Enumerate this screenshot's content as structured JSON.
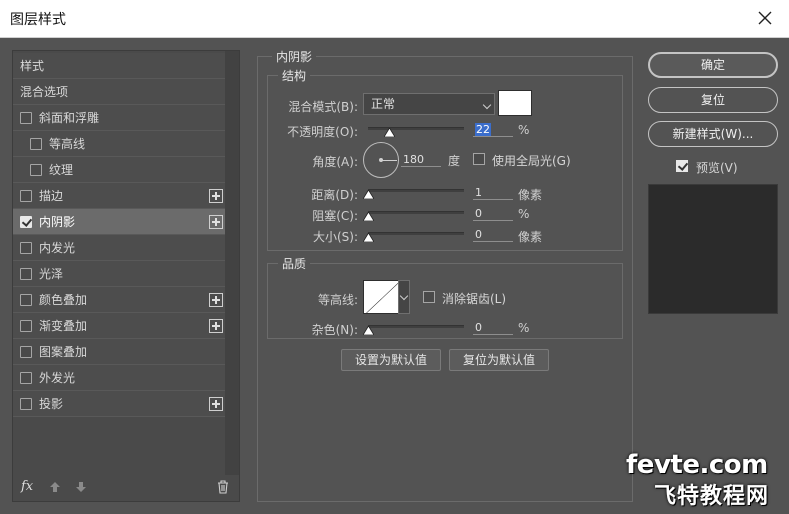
{
  "window": {
    "title": "图层样式"
  },
  "styles_list": {
    "header_styles": "样式",
    "header_blend": "混合选项",
    "items": [
      {
        "label": "斜面和浮雕",
        "checked": false,
        "indent": false,
        "plus": false,
        "selected": false
      },
      {
        "label": "等高线",
        "checked": false,
        "indent": true,
        "plus": false,
        "selected": false
      },
      {
        "label": "纹理",
        "checked": false,
        "indent": true,
        "plus": false,
        "selected": false
      },
      {
        "label": "描边",
        "checked": false,
        "indent": false,
        "plus": true,
        "selected": false
      },
      {
        "label": "内阴影",
        "checked": true,
        "indent": false,
        "plus": true,
        "selected": true
      },
      {
        "label": "内发光",
        "checked": false,
        "indent": false,
        "plus": false,
        "selected": false
      },
      {
        "label": "光泽",
        "checked": false,
        "indent": false,
        "plus": false,
        "selected": false
      },
      {
        "label": "颜色叠加",
        "checked": false,
        "indent": false,
        "plus": true,
        "selected": false
      },
      {
        "label": "渐变叠加",
        "checked": false,
        "indent": false,
        "plus": true,
        "selected": false
      },
      {
        "label": "图案叠加",
        "checked": false,
        "indent": false,
        "plus": false,
        "selected": false
      },
      {
        "label": "外发光",
        "checked": false,
        "indent": false,
        "plus": false,
        "selected": false
      },
      {
        "label": "投影",
        "checked": false,
        "indent": false,
        "plus": true,
        "selected": false
      }
    ],
    "fx_label": "fx"
  },
  "inner_shadow": {
    "title": "内阴影",
    "structure": {
      "title": "结构",
      "blend_mode_label": "混合模式(B):",
      "blend_mode_value": "正常",
      "shadow_color": "#ffffff",
      "opacity_label": "不透明度(O):",
      "opacity_value": "22",
      "opacity_unit": "%",
      "opacity_fraction": 0.22,
      "angle_label": "角度(A):",
      "angle_value": "180",
      "angle_unit": "度",
      "global_light_label": "使用全局光(G)",
      "global_light_checked": false,
      "distance_label": "距离(D):",
      "distance_value": "1",
      "distance_unit": "像素",
      "distance_fraction": 0.0,
      "choke_label": "阻塞(C):",
      "choke_value": "0",
      "choke_unit": "%",
      "choke_fraction": 0.0,
      "size_label": "大小(S):",
      "size_value": "0",
      "size_unit": "像素",
      "size_fraction": 0.0
    },
    "quality": {
      "title": "品质",
      "contour_label": "等高线:",
      "antialias_label": "消除锯齿(L)",
      "antialias_checked": false,
      "noise_label": "杂色(N):",
      "noise_value": "0",
      "noise_unit": "%",
      "noise_fraction": 0.0
    },
    "set_default_label": "设置为默认值",
    "reset_default_label": "复位为默认值"
  },
  "actions": {
    "ok_label": "确定",
    "reset_label": "复位",
    "new_style_label": "新建样式(W)...",
    "preview_label": "预览(V)",
    "preview_checked": true
  },
  "watermark": {
    "line1": "fevte.com",
    "line2": "飞特教程网"
  }
}
